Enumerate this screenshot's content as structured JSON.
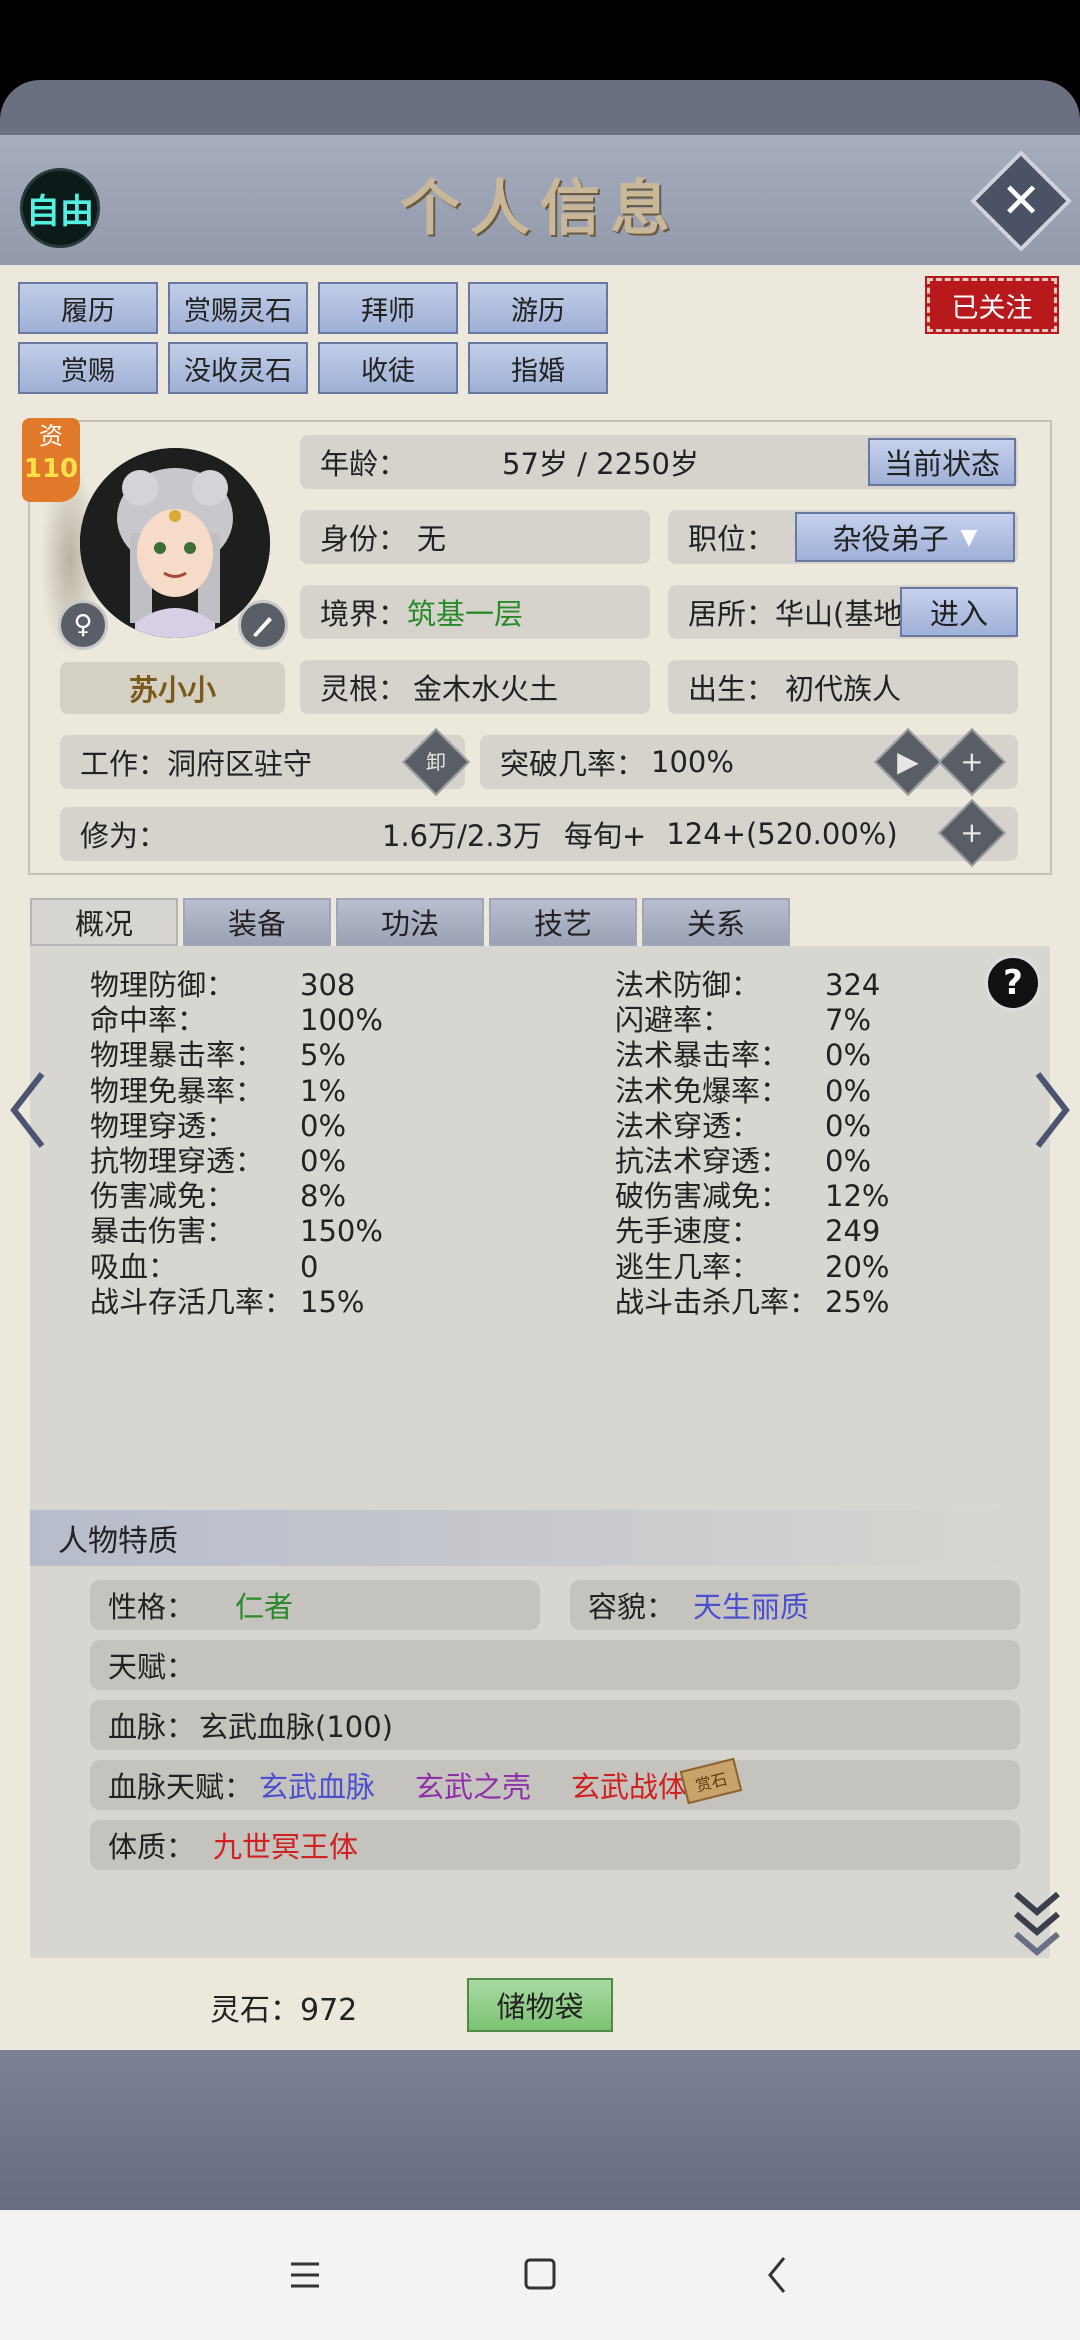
{
  "header": {
    "free_label": "自由",
    "title": "个人信息",
    "close_icon": "✕"
  },
  "top_buttons": {
    "row1": [
      "履历",
      "赏赐灵石",
      "拜师",
      "游历"
    ],
    "row2": [
      "赏赐",
      "没收灵石",
      "收徒",
      "指婚"
    ],
    "follow_label": "已关注"
  },
  "character": {
    "aptitude_label": "资",
    "aptitude_value": "110",
    "gender_icon": "♀",
    "name": "苏小小",
    "age_label": "年龄：",
    "age_value": "57岁 / 2250岁",
    "status_button": "当前状态",
    "identity_label": "身份：",
    "identity_value": "无",
    "position_label": "职位：",
    "position_value": "杂役弟子",
    "realm_label": "境界：",
    "realm_value": "筑基一层",
    "residence_label": "居所：",
    "residence_value": "华山(基地",
    "enter_button": "进入",
    "root_label": "灵根：",
    "root_value": "金木水火土",
    "birth_label": "出生：",
    "birth_value": "初代族人",
    "work_label": "工作：",
    "work_value": "洞府区驻守",
    "unequip_label": "卸",
    "breakthrough_label": "突破几率：",
    "breakthrough_value": "100%",
    "cultivation_label": "修为：",
    "cultivation_value": "1.6万/2.3万",
    "per_turn_label": "每旬+",
    "per_turn_value": "124+(520.00%)"
  },
  "tabs": [
    "概况",
    "装备",
    "功法",
    "技艺",
    "关系"
  ],
  "stats_left": [
    {
      "label": "物理防御：",
      "value": "308"
    },
    {
      "label": "命中率：",
      "value": "100%"
    },
    {
      "label": "物理暴击率：",
      "value": "5%"
    },
    {
      "label": "物理免暴率：",
      "value": "1%"
    },
    {
      "label": "物理穿透：",
      "value": "0%"
    },
    {
      "label": "抗物理穿透：",
      "value": "0%"
    },
    {
      "label": "伤害减免：",
      "value": "8%"
    },
    {
      "label": "暴击伤害：",
      "value": "150%"
    },
    {
      "label": "吸血：",
      "value": "0"
    },
    {
      "label": "战斗存活几率：",
      "value": "15%"
    }
  ],
  "stats_right": [
    {
      "label": "法术防御：",
      "value": "324"
    },
    {
      "label": "闪避率：",
      "value": "7%"
    },
    {
      "label": "法术暴击率：",
      "value": "0%"
    },
    {
      "label": "法术免爆率：",
      "value": "0%"
    },
    {
      "label": "法术穿透：",
      "value": "0%"
    },
    {
      "label": "抗法术穿透：",
      "value": "0%"
    },
    {
      "label": "破伤害减免：",
      "value": "12%"
    },
    {
      "label": "先手速度：",
      "value": "249"
    },
    {
      "label": "逃生几率：",
      "value": "20%"
    },
    {
      "label": "战斗击杀几率：",
      "value": "25%"
    }
  ],
  "traits": {
    "section_title": "人物特质",
    "personality_label": "性格：",
    "personality_value": "仁者",
    "appearance_label": "容貌：",
    "appearance_value": "天生丽质",
    "talent_label": "天赋：",
    "bloodline_label": "血脉：",
    "bloodline_value": "玄武血脉(100)",
    "bloodline_talent_label": "血脉天赋：",
    "bloodline_talents": [
      "玄武血脉",
      "玄武之壳",
      "玄武战体"
    ],
    "stamp_text": "赏石",
    "physique_label": "体质：",
    "physique_value": "九世冥王体"
  },
  "footer": {
    "stone_label": "灵石：",
    "stone_value": "972",
    "bag_button": "储物袋"
  },
  "colors": {
    "green": "#2a8a2a",
    "blue": "#4a50d0",
    "purple": "#9030a8",
    "red": "#d02020",
    "follow": "#b8191d"
  }
}
